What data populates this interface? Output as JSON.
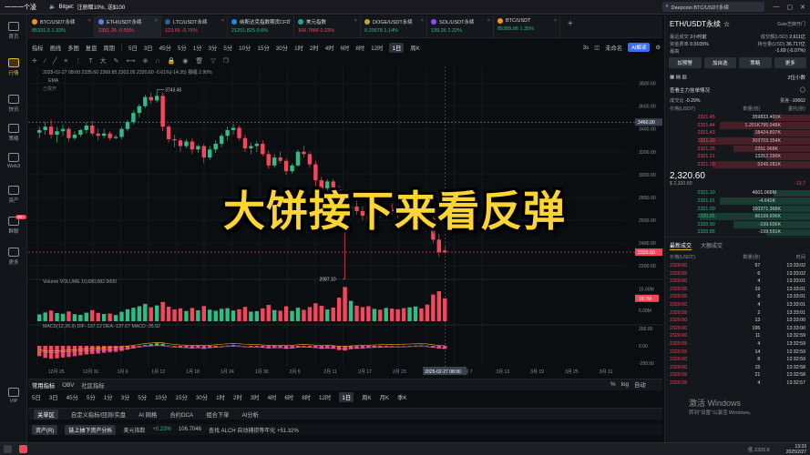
{
  "topbar": {
    "app_name": "一一一个凌",
    "notice_brand": "Bitget:",
    "notice_text": "注册赠10%, 送$100",
    "search_text": "Deepcoin BTC/USDT永续"
  },
  "nav": [
    {
      "label": "首页",
      "active": false
    },
    {
      "label": "行情",
      "active": true
    },
    {
      "label": "快讯",
      "active": false
    },
    {
      "label": "策略",
      "active": false
    },
    {
      "label": "Web3",
      "active": false
    },
    {
      "label": "资产",
      "active": false
    },
    {
      "label": "群聊",
      "active": false,
      "badge": "99+"
    },
    {
      "label": "更多",
      "active": false
    },
    {
      "label": "VIP",
      "active": false
    }
  ],
  "tickers": [
    {
      "name": "BTC/USDT永续",
      "price": "85331.5",
      "change": "1.33%",
      "dir": "up",
      "color": "#f7931a",
      "active": false
    },
    {
      "name": "ETH/USDT永续",
      "price": "2331.25",
      "change": "-0.59%",
      "dir": "down",
      "color": "#627eea",
      "active": true
    },
    {
      "name": "LTC/USDT永续",
      "price": "123.65",
      "change": "-0.76%",
      "dir": "down",
      "color": "#345d9d",
      "active": false
    },
    {
      "name": "纳斯达克指数期货CFD",
      "price": "21201.825",
      "change": "0.6%",
      "dir": "up",
      "color": "#1e88e5",
      "active": false
    },
    {
      "name": "美元指数",
      "price": "106.7866",
      "change": "0.23%",
      "dir": "down",
      "color": "#26a69a",
      "active": false
    },
    {
      "name": "DOGE/USDT永续",
      "price": "0.20578",
      "change": "1.14%",
      "dir": "up",
      "color": "#c2a633",
      "active": false
    },
    {
      "name": "SOL/USDT永续",
      "price": "139.26",
      "change": "2.22%",
      "dir": "up",
      "color": "#9945ff",
      "active": false
    },
    {
      "name": "BTC/USDT",
      "price": "85389.86",
      "change": "1.35%",
      "dir": "up",
      "color": "#f7931a",
      "active": false
    }
  ],
  "toolbar1": {
    "items": [
      "指标",
      "画线",
      "多图",
      "复盘",
      "周期"
    ],
    "timeframes": [
      "5日",
      "3日",
      "45分",
      "5分",
      "1分",
      "3分",
      "5分",
      "10分",
      "15分",
      "30分",
      "1时",
      "2时",
      "4时",
      "6时",
      "8时",
      "12时",
      "1日",
      "周K"
    ],
    "active_tf": "1日",
    "right": [
      "3s",
      "未命名",
      "AI解读"
    ]
  },
  "chart_data": {
    "type": "candlestick",
    "symbol": "ETH/USDT",
    "interval": "1日",
    "info_line": "2025-02-27 08:00   2335.60  2369.85  2302.05  2320.60  -0.61%(-14.35)  振幅 2.90%",
    "ema_label": "EMA",
    "hint_label": "已展开",
    "y_ticks": [
      "3800.00",
      "3600.00",
      "3400.00",
      "3200.00",
      "3000.00",
      "2800.00",
      "2600.00",
      "2400.00",
      "2200.00"
    ],
    "ylim": [
      2130,
      3900
    ],
    "last_price": "2320.60",
    "hline_price": "3460.00",
    "x_ticks": [
      "12月 25",
      "12月 31",
      "1月 6",
      "1月 12",
      "1月 18",
      "1月 24",
      "1月 30",
      "2月 5",
      "2月 11",
      "2月 17",
      "2月 23",
      "3月 1",
      "3月 7",
      "3月 13",
      "3月 19",
      "3月 25",
      "3月 31"
    ],
    "x_cursor_label": "2025-02-27 08:00",
    "annotations": [
      {
        "label": "3743.45",
        "value": 3743.45
      },
      {
        "label": "2087.10",
        "value": 2087.1
      }
    ],
    "candles": [
      [
        3367,
        3420,
        3320,
        3390
      ],
      [
        3390,
        3460,
        3350,
        3420
      ],
      [
        3420,
        3480,
        3320,
        3350
      ],
      [
        3350,
        3420,
        3280,
        3380
      ],
      [
        3380,
        3440,
        3340,
        3400
      ],
      [
        3400,
        3420,
        3290,
        3320
      ],
      [
        3320,
        3380,
        3300,
        3350
      ],
      [
        3350,
        3400,
        3330,
        3390
      ],
      [
        3390,
        3460,
        3360,
        3430
      ],
      [
        3430,
        3470,
        3340,
        3360
      ],
      [
        3360,
        3400,
        3300,
        3340
      ],
      [
        3340,
        3400,
        3320,
        3360
      ],
      [
        3360,
        3380,
        3300,
        3320
      ],
      [
        3320,
        3350,
        3310,
        3330
      ],
      [
        3330,
        3420,
        3310,
        3400
      ],
      [
        3400,
        3480,
        3380,
        3460
      ],
      [
        3460,
        3560,
        3440,
        3540
      ],
      [
        3540,
        3620,
        3500,
        3600
      ],
      [
        3600,
        3700,
        3580,
        3680
      ],
      [
        3680,
        3720,
        3620,
        3650
      ],
      [
        3650,
        3743,
        3630,
        3690
      ],
      [
        3690,
        3720,
        3380,
        3420
      ],
      [
        3420,
        3440,
        3280,
        3310
      ],
      [
        3310,
        3350,
        3240,
        3300
      ],
      [
        3300,
        3320,
        3200,
        3250
      ],
      [
        3250,
        3310,
        3230,
        3290
      ],
      [
        3290,
        3320,
        3180,
        3220
      ],
      [
        3220,
        3260,
        3190,
        3250
      ],
      [
        3250,
        3270,
        3100,
        3150
      ],
      [
        3150,
        3250,
        3130,
        3220
      ],
      [
        3220,
        3300,
        3190,
        3270
      ],
      [
        3270,
        3360,
        3240,
        3340
      ],
      [
        3340,
        3420,
        3300,
        3390
      ],
      [
        3390,
        3450,
        3350,
        3410
      ],
      [
        3410,
        3430,
        3300,
        3320
      ],
      [
        3320,
        3350,
        3200,
        3230
      ],
      [
        3230,
        3280,
        3180,
        3250
      ],
      [
        3250,
        3290,
        3200,
        3270
      ],
      [
        3270,
        3300,
        3160,
        3180
      ],
      [
        3180,
        3210,
        3050,
        3080
      ],
      [
        3080,
        3180,
        3060,
        3150
      ],
      [
        3150,
        3200,
        3100,
        3120
      ],
      [
        3120,
        3140,
        3000,
        3030
      ],
      [
        3030,
        3100,
        3010,
        3080
      ],
      [
        3080,
        3220,
        3070,
        3200
      ],
      [
        3200,
        3250,
        3150,
        3180
      ],
      [
        3180,
        3200,
        3060,
        3090
      ],
      [
        3090,
        3120,
        2900,
        2950
      ],
      [
        2950,
        2980,
        2850,
        2880
      ],
      [
        2880,
        2960,
        2860,
        2940
      ],
      [
        2940,
        2960,
        2840,
        2870
      ],
      [
        2870,
        2900,
        2620,
        2660
      ],
      [
        2660,
        2680,
        2087,
        2620
      ],
      [
        2620,
        2760,
        2600,
        2720
      ],
      [
        2720,
        2800,
        2650,
        2680
      ],
      [
        2680,
        2720,
        2600,
        2640
      ],
      [
        2640,
        2700,
        2580,
        2600
      ],
      [
        2600,
        2690,
        2570,
        2660
      ],
      [
        2660,
        2700,
        2620,
        2650
      ],
      [
        2650,
        2720,
        2630,
        2700
      ],
      [
        2700,
        2750,
        2640,
        2680
      ],
      [
        2680,
        2720,
        2620,
        2650
      ],
      [
        2650,
        2700,
        2600,
        2640
      ],
      [
        2640,
        2720,
        2630,
        2700
      ],
      [
        2700,
        2760,
        2660,
        2720
      ],
      [
        2720,
        2760,
        2660,
        2680
      ],
      [
        2680,
        2720,
        2600,
        2620
      ],
      [
        2620,
        2650,
        2400,
        2430
      ],
      [
        2430,
        2480,
        2280,
        2320
      ],
      [
        2335,
        2369,
        2302,
        2320
      ]
    ],
    "volume_label": "Volume  VOLUME 10,680,082.0000",
    "volume_ticks": [
      "15.00M",
      "10.00M",
      "5.00M"
    ],
    "volume_last": "10.7M",
    "volumes": [
      3.2,
      4.1,
      5.0,
      3.8,
      3.5,
      4.6,
      3.3,
      3.0,
      4.0,
      5.2,
      3.9,
      3.4,
      3.6,
      2.9,
      4.4,
      5.6,
      6.3,
      7.0,
      8.1,
      6.5,
      7.4,
      9.0,
      6.8,
      5.5,
      6.0,
      4.8,
      6.2,
      5.1,
      7.1,
      5.4,
      4.9,
      5.8,
      6.1,
      5.0,
      5.6,
      6.7,
      4.5,
      4.7,
      6.0,
      7.6,
      5.2,
      4.9,
      7.0,
      4.8,
      6.3,
      5.3,
      6.6,
      8.4,
      7.2,
      5.5,
      6.4,
      11.0,
      16.0,
      9.5,
      7.3,
      6.6,
      7.0,
      5.8,
      5.4,
      6.2,
      5.9,
      5.6,
      6.1,
      6.5,
      6.9,
      6.0,
      7.8,
      12.5,
      14.0,
      10.7
    ],
    "macd_label": "MACD(12,26,9)  DIF:-137.12  DEA:-137.67  MACD:-35.92",
    "macd_ticks": [
      "200.00",
      "0.00",
      "-200.00"
    ],
    "macd_hist": [
      -120,
      -140,
      -150,
      -145,
      -135,
      -130,
      -120,
      -110,
      -100,
      -95,
      -90,
      -80,
      -75,
      -70,
      -60,
      -45,
      -30,
      -10,
      10,
      20,
      30,
      25,
      5,
      -10,
      -20,
      -25,
      -30,
      -25,
      -35,
      -25,
      -15,
      -5,
      5,
      10,
      5,
      -5,
      -10,
      -10,
      -20,
      -30,
      -25,
      -25,
      -35,
      -30,
      -15,
      -10,
      -15,
      -25,
      -35,
      -30,
      -35,
      -50,
      -55,
      -40,
      -35,
      -30,
      -25,
      -20,
      -15,
      -10,
      -8,
      -6,
      -4,
      0,
      4,
      6,
      2,
      -15,
      -30,
      -36
    ]
  },
  "bottom_tf": {
    "timeframes": [
      "5日",
      "3日",
      "45分",
      "5分",
      "1分",
      "3分",
      "5分",
      "10分",
      "15分",
      "30分",
      "1时",
      "2时",
      "3时",
      "4时",
      "6时",
      "8时",
      "12时",
      "1日",
      "周K",
      "月K",
      "季K"
    ],
    "active_tf": "1日",
    "indicators": [
      "常用指标",
      "OBV",
      "社区指标"
    ],
    "right": [
      "%",
      "log",
      "自动"
    ]
  },
  "bottom_tabs": {
    "items": [
      "关单区",
      "自定义指标/回测/实盘",
      "AI 网格",
      "合约DCA",
      "组合下单",
      "AI分析"
    ],
    "active": "关单区"
  },
  "asset_row": {
    "items": [
      "资产(R)",
      "链上抽下资产分析"
    ],
    "quote_name": "美元指数",
    "quote_change": "+0.23%",
    "quote_price": "106.7046",
    "extra": "查找  ALCH 自动捕捞等年化  +51.32%"
  },
  "right_panel": {
    "title": "ETH/USDT永续",
    "sub": "Gate芝麻开门",
    "stats": [
      {
        "k": "最近成交",
        "v": "2小时前"
      },
      {
        "k": "成交额(USD)",
        "v": "2,611亿"
      },
      {
        "k": "资金费率",
        "v": "0.0105%"
      },
      {
        "k": "持仓量(USD)",
        "v": "36.717亿"
      }
    ],
    "price_row": {
      "label": "最高",
      "change": "-1.69 (-0.07%)"
    },
    "actions": [
      "加预警",
      "加自选",
      "策略",
      "更多"
    ],
    "depth_label": "2位小数",
    "flow_title": "查看主力挂单情况",
    "flow_values": [
      {
        "k": "成交比",
        "v": "-0.29%"
      },
      {
        "k": "委差",
        "v": "-10662"
      }
    ],
    "ob_head": [
      "价格(USDT)",
      "数量(张)",
      "委托(张)"
    ],
    "asks": [
      [
        "2321.45",
        "359",
        "833.401K"
      ],
      [
        "2321.44",
        "1.201K",
        "795.048K"
      ],
      [
        "2321.43",
        "18",
        "424.807K"
      ],
      [
        "2321.30",
        "303",
        "703.354K"
      ],
      [
        "2321.25",
        "22",
        "51.068K"
      ],
      [
        "2321.21",
        "13",
        "262.296K"
      ],
      [
        "2321.20",
        "5",
        "249.281K"
      ]
    ],
    "mid_price": "2,320.60",
    "mid_sub": "$ 2,320.60",
    "mid_right": "-13.7",
    "bids": [
      [
        "2321.10",
        "460",
        "1.068M"
      ],
      [
        "2321.01",
        "-",
        "4.642K"
      ],
      [
        "2321.00",
        "160",
        "371.368K"
      ],
      [
        "2320.95",
        "86",
        "199.606K"
      ],
      [
        "2320.90",
        "-",
        "199.606K"
      ],
      [
        "2320.85",
        "-",
        "199.591K"
      ]
    ],
    "trades_tabs": [
      "最新成交",
      "大额成交"
    ],
    "trades_head": [
      "价格(USDT)",
      "数量(张)",
      "时间"
    ],
    "trades": [
      [
        "2320.60",
        "57",
        "13:33:02"
      ],
      [
        "2320.65",
        "6",
        "13:33:02"
      ],
      [
        "2320.60",
        "4",
        "13:33:01"
      ],
      [
        "2320.55",
        "19",
        "13:33:01"
      ],
      [
        "2320.55",
        "8",
        "13:33:01"
      ],
      [
        "2320.60",
        "4",
        "13:33:01"
      ],
      [
        "2320.55",
        "2",
        "13:33:01"
      ],
      [
        "2320.60",
        "13",
        "13:33:00"
      ],
      [
        "2320.60",
        "195",
        "13:33:00"
      ],
      [
        "2320.60",
        "11",
        "13:32:59"
      ],
      [
        "2320.55",
        "4",
        "13:32:59"
      ],
      [
        "2320.55",
        "14",
        "13:32:59"
      ],
      [
        "2320.60",
        "8",
        "13:32:59"
      ],
      [
        "2320.60",
        "15",
        "13:32:58"
      ],
      [
        "2320.55",
        "21",
        "13:32:58"
      ],
      [
        "2320.55",
        "4",
        "13:32:57"
      ]
    ]
  },
  "caption": "大饼接下来看反弹",
  "watermark": {
    "line1": "激活 Windows",
    "line2": "转到\"设置\"以激活 Windows。"
  },
  "taskbar": {
    "time": "13:33",
    "date": "2025/2/27",
    "status": "低 2320.6"
  },
  "colors": {
    "up": "#2ebd85",
    "down": "#f6465d",
    "accent": "#f0b90b",
    "caption": "#fcd535"
  }
}
